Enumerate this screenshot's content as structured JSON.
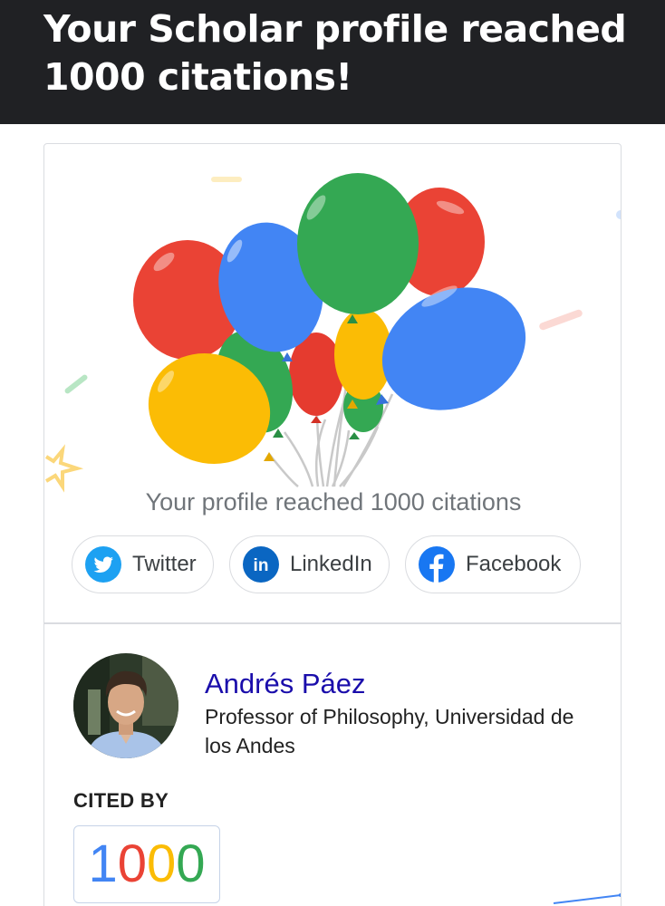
{
  "header": {
    "title": "Your Scholar profile reached 1000 citations!"
  },
  "card": {
    "milestone_text": "Your profile reached 1000 citations",
    "share": [
      {
        "label": "Twitter",
        "icon": "twitter-icon"
      },
      {
        "label": "LinkedIn",
        "icon": "linkedin-icon"
      },
      {
        "label": "Facebook",
        "icon": "facebook-icon"
      }
    ],
    "balloon_colors": [
      "#ea4335",
      "#4285f4",
      "#34a853",
      "#fbbc05"
    ]
  },
  "profile": {
    "name": "Andrés Páez",
    "affiliation": "Professor of Philosophy, Universidad de los Andes",
    "cited_by_label": "CITED BY",
    "citations": [
      "1",
      "0",
      "0",
      "0"
    ],
    "citation_digit_colors": [
      "#4285f4",
      "#ea4335",
      "#fbbc05",
      "#34a853"
    ]
  },
  "colors": {
    "header_bg": "#202124",
    "link": "#1a0dab",
    "twitter": "#1da1f2",
    "linkedin": "#0a66c2",
    "facebook": "#1877f2"
  }
}
